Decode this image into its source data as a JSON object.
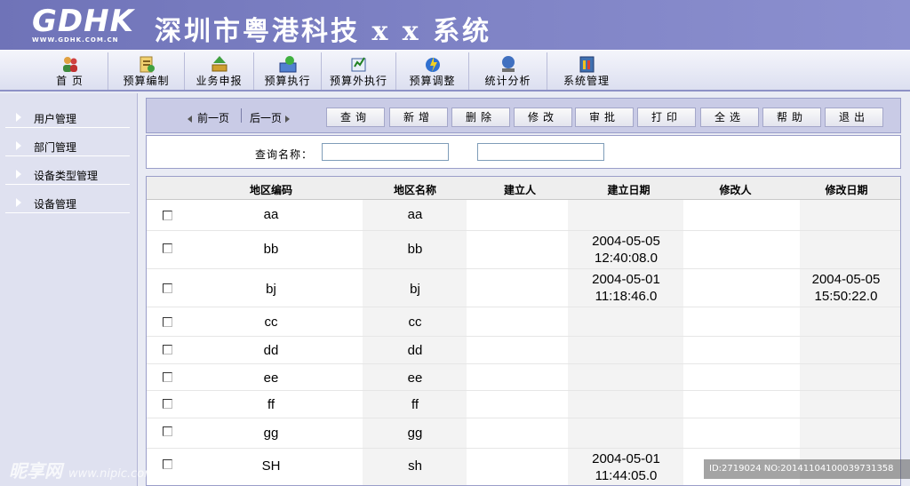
{
  "header": {
    "logo_text": "GDHK",
    "logo_url": "WWW.GDHK.COM.CN",
    "system_title": "深圳市粤港科技 x x 系统"
  },
  "toolbar": {
    "items": [
      {
        "label": "首 页",
        "icon": "home-users-icon"
      },
      {
        "label": "预算编制",
        "icon": "budget-prep-icon"
      },
      {
        "label": "业务申报",
        "icon": "business-report-icon"
      },
      {
        "label": "预算执行",
        "icon": "budget-exec-icon"
      },
      {
        "label": "预算外执行",
        "icon": "extra-budget-icon"
      },
      {
        "label": "预算调整",
        "icon": "budget-adjust-icon"
      },
      {
        "label": "统计分析",
        "icon": "statistics-icon"
      },
      {
        "label": "系统管理",
        "icon": "system-manage-icon"
      }
    ]
  },
  "sidebar": {
    "items": [
      {
        "label": "用户管理"
      },
      {
        "label": "部门管理"
      },
      {
        "label": "设备类型管理"
      },
      {
        "label": "设备管理"
      }
    ]
  },
  "actions": {
    "prev_page": "前一页",
    "next_page": "后一页",
    "buttons": [
      "查询",
      "新增",
      "删除",
      "修改",
      "审批",
      "打印",
      "全选",
      "帮助",
      "退出"
    ]
  },
  "query": {
    "label": "查询名称：",
    "input1_value": "",
    "input2_value": ""
  },
  "table": {
    "headers": [
      "地区编码",
      "地区名称",
      "建立人",
      "建立日期",
      "修改人",
      "修改日期"
    ],
    "rows": [
      {
        "code": "aa",
        "name": "aa",
        "creator": "",
        "created": "",
        "modifier": "",
        "modified": ""
      },
      {
        "code": "bb",
        "name": "bb",
        "creator": "",
        "created": "2004-05-05 12:40:08.0",
        "modifier": "",
        "modified": ""
      },
      {
        "code": "bj",
        "name": "bj",
        "creator": "",
        "created": "2004-05-01 11:18:46.0",
        "modifier": "",
        "modified": "2004-05-05 15:50:22.0"
      },
      {
        "code": "cc",
        "name": "cc",
        "creator": "",
        "created": "",
        "modifier": "",
        "modified": ""
      },
      {
        "code": "dd",
        "name": "dd",
        "creator": "",
        "created": "",
        "modifier": "",
        "modified": ""
      },
      {
        "code": "ee",
        "name": "ee",
        "creator": "",
        "created": "",
        "modifier": "",
        "modified": ""
      },
      {
        "code": "ff",
        "name": "ff",
        "creator": "",
        "created": "",
        "modifier": "",
        "modified": ""
      },
      {
        "code": "gg",
        "name": "gg",
        "creator": "",
        "created": "",
        "modifier": "",
        "modified": ""
      },
      {
        "code": "SH",
        "name": "sh",
        "creator": "",
        "created": "2004-05-01 11:44:05.0",
        "modifier": "",
        "modified": ""
      }
    ]
  },
  "watermark": {
    "left": "昵享网",
    "left_url": "www.nipic.com",
    "right": "ID:2719024 NO:20141104100039731358"
  }
}
